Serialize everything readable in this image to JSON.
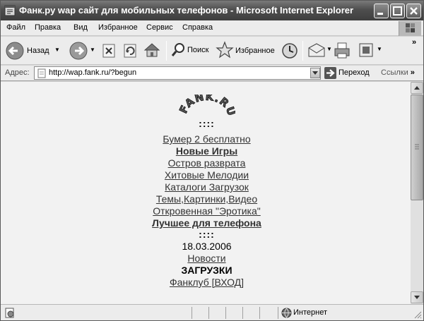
{
  "window": {
    "title": "Фанк.ру wap сайт для мобильных телефонов - Microsoft Internet Explorer"
  },
  "menu": [
    {
      "label": "Файл"
    },
    {
      "label": "Правка"
    },
    {
      "label": "Вид"
    },
    {
      "label": "Избранное"
    },
    {
      "label": "Сервис"
    },
    {
      "label": "Справка"
    }
  ],
  "toolbar": {
    "back_label": "Назад",
    "search_label": "Поиск",
    "favorites_label": "Избранное",
    "more": "»"
  },
  "address": {
    "label": "Адрес:",
    "value": "http://wap.fank.ru/?begun",
    "go_label": "Переход",
    "links_label": "Ссылки",
    "more": "»"
  },
  "page": {
    "logo_text": "FANK.RU",
    "separator": "::::",
    "items": [
      {
        "text": "Бумер 2 бесплатно",
        "link": true,
        "bold": false
      },
      {
        "text": "Новые Игры",
        "link": true,
        "bold": true
      },
      {
        "text": "Остров разврата",
        "link": true,
        "bold": false
      },
      {
        "text": "Хитовые Мелодии",
        "link": true,
        "bold": false
      },
      {
        "text": "Каталоги Загрузок",
        "link": true,
        "bold": false
      },
      {
        "text": "Темы,Картинки,Видео",
        "link": true,
        "bold": false
      },
      {
        "text": "Откровенная \"Эротика\"",
        "link": true,
        "bold": false
      },
      {
        "text": "Лучшее для телефона",
        "link": true,
        "bold": true
      }
    ],
    "date": "18.03.2006",
    "news": "Новости",
    "downloads": "ЗАГРУЗКИ",
    "fanclub": "Фанклуб [ВХОД]"
  },
  "status": {
    "zone": "Интернет"
  },
  "icons": [
    "ie-icon",
    "minimize-icon",
    "maximize-icon",
    "close-icon",
    "windows-logo-icon",
    "back-icon",
    "forward-icon",
    "stop-icon",
    "refresh-icon",
    "home-icon",
    "search-icon",
    "favorites-icon",
    "history-icon",
    "mail-icon",
    "print-icon",
    "edit-icon",
    "page-icon",
    "go-icon",
    "globe-icon"
  ]
}
